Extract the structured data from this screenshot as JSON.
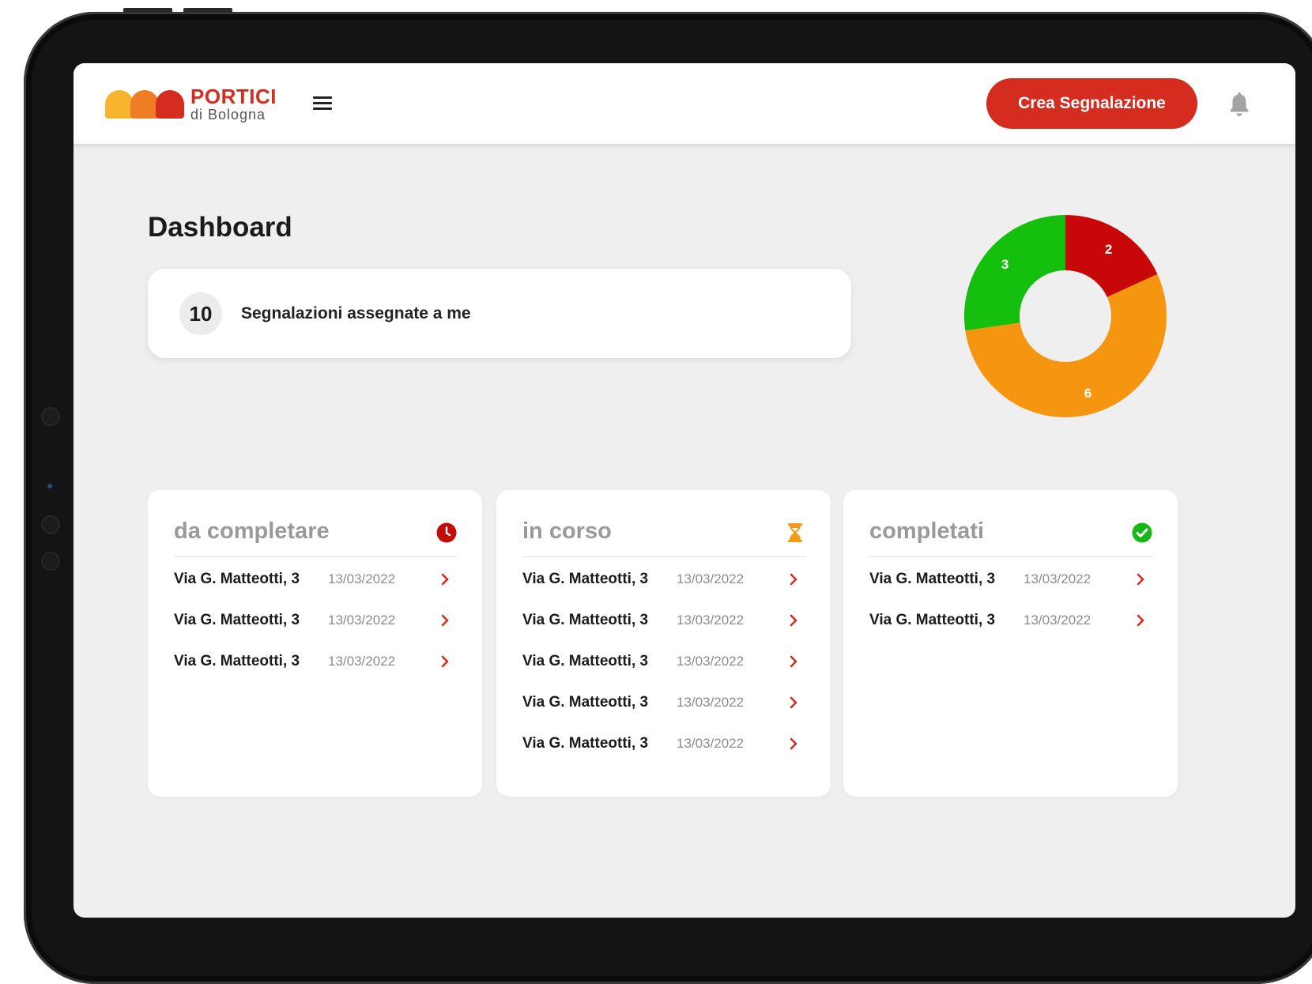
{
  "header": {
    "logo_title": "PORTICI",
    "logo_subtitle": "di Bologna",
    "cta_label": "Crea Segnalazione",
    "brand_colors": {
      "red": "#d42c1f",
      "orange": "#ef7d25",
      "yellow": "#f7b52d"
    }
  },
  "page": {
    "title": "Dashboard"
  },
  "assigned": {
    "count": "10",
    "label": "Segnalazioni assegnate a me"
  },
  "chart_data": {
    "type": "pie",
    "donut": true,
    "slices": [
      {
        "label": "2",
        "value": 2,
        "color": "#c80808"
      },
      {
        "label": "6",
        "value": 6,
        "color": "#f6950f"
      },
      {
        "label": "3",
        "value": 3,
        "color": "#14bf0e"
      }
    ]
  },
  "columns": [
    {
      "title": "da completare",
      "icon": "clock-icon",
      "icon_color": "#c20b0b",
      "rows": [
        {
          "address": "Via G. Matteotti, 3",
          "date": "13/03/2022"
        },
        {
          "address": "Via G. Matteotti, 3",
          "date": "13/03/2022"
        },
        {
          "address": "Via G. Matteotti, 3",
          "date": "13/03/2022"
        }
      ]
    },
    {
      "title": "in corso",
      "icon": "hourglass-icon",
      "icon_color": "#f39a19",
      "rows": [
        {
          "address": "Via G. Matteotti, 3",
          "date": "13/03/2022"
        },
        {
          "address": "Via G. Matteotti, 3",
          "date": "13/03/2022"
        },
        {
          "address": "Via G. Matteotti, 3",
          "date": "13/03/2022"
        },
        {
          "address": "Via G. Matteotti, 3",
          "date": "13/03/2022"
        },
        {
          "address": "Via G. Matteotti, 3",
          "date": "13/03/2022"
        }
      ]
    },
    {
      "title": "completati",
      "icon": "check-circle-icon",
      "icon_color": "#18b718",
      "rows": [
        {
          "address": "Via G. Matteotti, 3",
          "date": "13/03/2022"
        },
        {
          "address": "Via G. Matteotti, 3",
          "date": "13/03/2022"
        }
      ]
    }
  ]
}
